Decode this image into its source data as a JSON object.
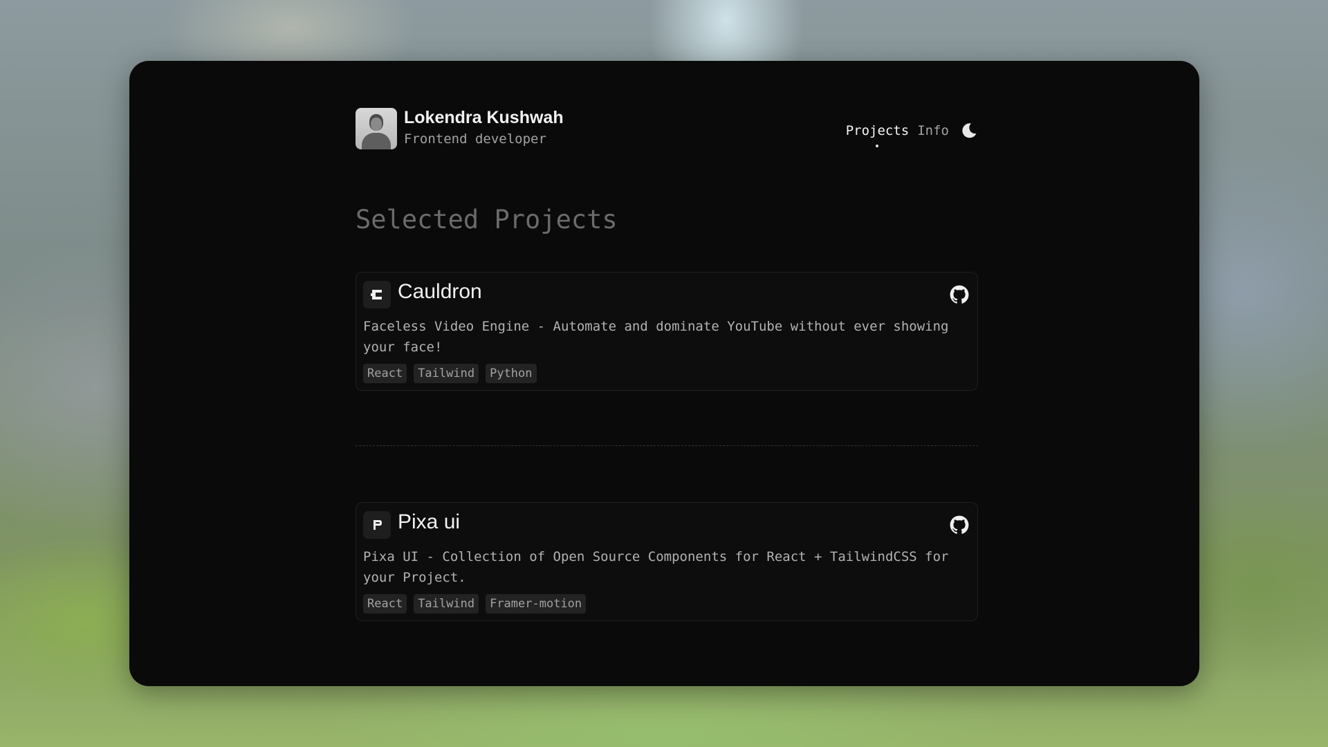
{
  "header": {
    "name": "Lokendra Kushwah",
    "role": "Frontend developer",
    "nav": [
      {
        "label": "Projects",
        "active": true
      },
      {
        "label": "Info",
        "active": false
      }
    ],
    "theme_icon": "moon-icon"
  },
  "main": {
    "section_title": "Selected Projects",
    "projects": [
      {
        "icon": "cauldron-logo-icon",
        "icon_glyph": "C",
        "title": "Cauldron",
        "description": "Faceless Video Engine - Automate and dominate YouTube without ever showing your face!",
        "tags": [
          "React",
          "Tailwind",
          "Python"
        ],
        "link_icon": "github-icon"
      },
      {
        "icon": "pixa-ui-logo-icon",
        "icon_glyph": "P",
        "title": "Pixa ui",
        "description": "Pixa UI - Collection of Open Source Components for React + TailwindCSS for your Project.",
        "tags": [
          "React",
          "Tailwind",
          "Framer-motion"
        ],
        "link_icon": "github-icon"
      }
    ]
  },
  "colors": {
    "window_bg": "#0a0a0a",
    "card_bg": "#0d0d0d",
    "text_primary": "#f2f2f2",
    "text_secondary": "#a3a3a3",
    "tag_bg": "#232323"
  }
}
